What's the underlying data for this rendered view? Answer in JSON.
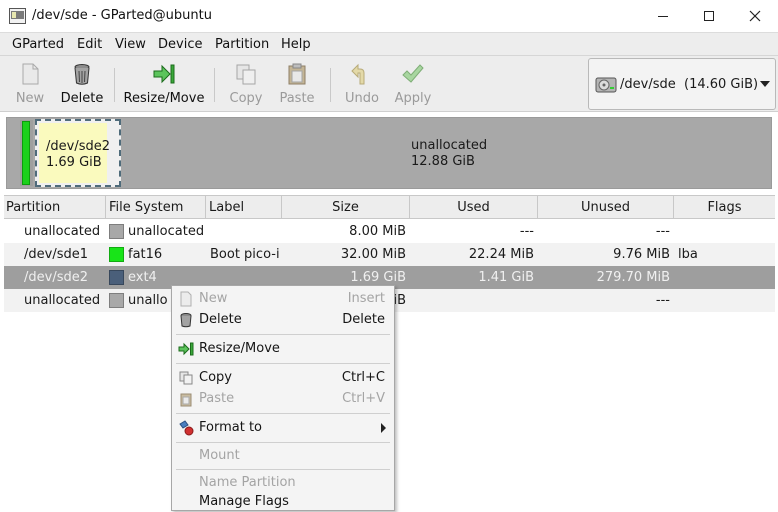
{
  "window": {
    "title": "/dev/sde - GParted@ubuntu"
  },
  "menubar": {
    "items": [
      "GParted",
      "Edit",
      "View",
      "Device",
      "Partition",
      "Help"
    ]
  },
  "toolbar": {
    "new": "New",
    "delete": "Delete",
    "resize_move": "Resize/Move",
    "copy": "Copy",
    "paste": "Paste",
    "undo": "Undo",
    "apply": "Apply"
  },
  "device_selector": {
    "label": "/dev/sde  (14.60 GiB)"
  },
  "disk_visual": {
    "sde2": {
      "name": "/dev/sde2",
      "size": "1.69 GiB"
    },
    "unallocated": {
      "name": "unallocated",
      "size": "12.88 GiB"
    }
  },
  "table": {
    "columns": [
      "Partition",
      "File System",
      "Label",
      "Size",
      "Used",
      "Unused",
      "Flags"
    ],
    "rows": [
      {
        "partition": "unallocated",
        "fs": "unallocated",
        "label": "",
        "size": "8.00 MiB",
        "used": "---",
        "unused": "---",
        "flags": "",
        "color": "#a8a8a8"
      },
      {
        "partition": "/dev/sde1",
        "fs": "fat16",
        "label": "Boot pico-i",
        "size": "32.00 MiB",
        "used": "22.24 MiB",
        "unused": "9.76 MiB",
        "flags": "lba",
        "color": "#18e418"
      },
      {
        "partition": "/dev/sde2",
        "fs": "ext4",
        "label": "",
        "size": "1.69 GiB",
        "used": "1.41 GiB",
        "unused": "279.70 MiB",
        "flags": "",
        "color": "#4a5f7a"
      },
      {
        "partition": "unallocated",
        "fs": "unallo",
        "label": "",
        "size": "iB",
        "used": "",
        "unused": "---",
        "flags": "",
        "color": "#a8a8a8"
      }
    ]
  },
  "context_menu": {
    "new": {
      "label": "New",
      "key": "Insert"
    },
    "delete": {
      "label": "Delete",
      "key": "Delete"
    },
    "resize_move": {
      "label": "Resize/Move"
    },
    "copy": {
      "label": "Copy",
      "key": "Ctrl+C"
    },
    "paste": {
      "label": "Paste",
      "key": "Ctrl+V"
    },
    "format_to": {
      "label": "Format to"
    },
    "mount": {
      "label": "Mount"
    },
    "name_partition": {
      "label": "Name Partition"
    },
    "manage_flags": {
      "label": "Manage Flags"
    }
  }
}
